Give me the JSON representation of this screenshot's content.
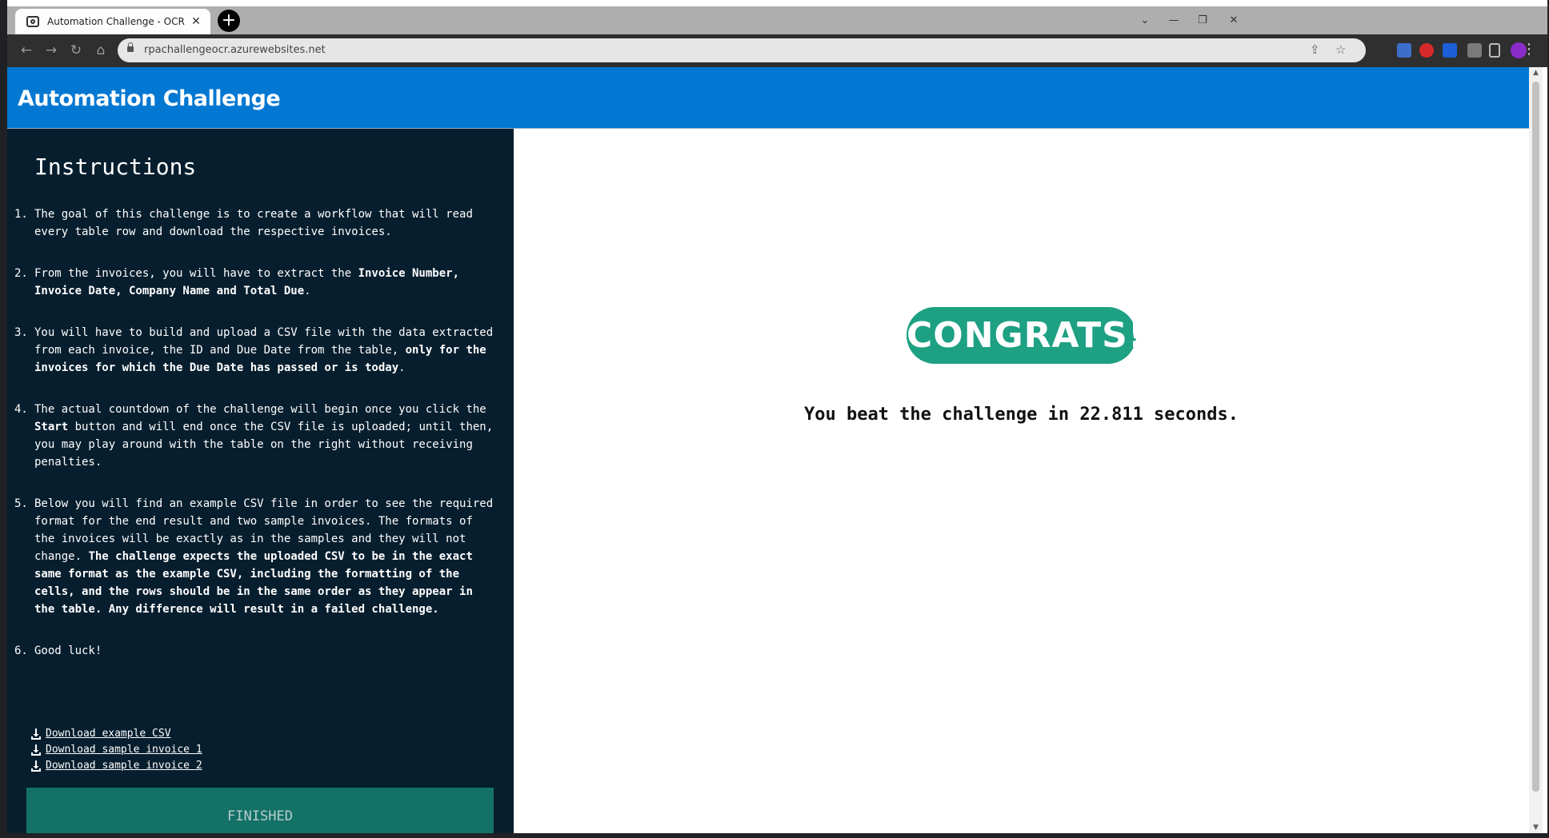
{
  "browser": {
    "tab_title": "Automation Challenge - OCR",
    "url": "rpachallengeocr.azurewebsites.net"
  },
  "app": {
    "title": "Automation Challenge"
  },
  "sidebar": {
    "title": "Instructions",
    "instructions": [
      {
        "num": "1.",
        "text": "The goal of this challenge is to create a workflow that will read every table row and download the respective invoices."
      },
      {
        "num": "2.",
        "text_a": "From the invoices, you will have to extract the ",
        "bold_a": "Invoice Number, Invoice Date, Company Name and Total Due",
        "text_b": "."
      },
      {
        "num": "3.",
        "text_a": "You will have to build and upload a CSV file with the data extracted from each invoice, the ID and Due Date from the table, ",
        "bold_a": "only for the invoices for which the Due Date has passed or is today",
        "text_b": "."
      },
      {
        "num": "4.",
        "text_a": "The actual countdown of the challenge will begin once you click the ",
        "bold_a": "Start",
        "text_b": " button and will end once the CSV file is uploaded; until then, you may play around with the table on the right without receiving penalties."
      },
      {
        "num": "5.",
        "text_a": "Below you will find an example CSV file in order to see the required format for the end result and two sample invoices. The formats of the invoices will be exactly as in the samples and they will not change. ",
        "bold_a": "The challenge expects the uploaded CSV to be in the exact same format as the example CSV, including the formatting of the cells, and the rows should be in the same order as they appear in the table. Any difference will result in a failed challenge."
      },
      {
        "num": "6.",
        "text": "Good luck!"
      }
    ],
    "downloads": [
      "Download example CSV",
      "Download sample invoice 1",
      "Download sample invoice 2"
    ],
    "finished_label": "FINISHED"
  },
  "main": {
    "congrats_label": "CONGRATS!",
    "result_text": "You beat the challenge in 22.811 seconds."
  },
  "colors": {
    "header_blue": "#0378d2",
    "sidebar_dark": "#071e2e",
    "congrats_green": "#1ea083",
    "finished_teal": "#137168"
  }
}
